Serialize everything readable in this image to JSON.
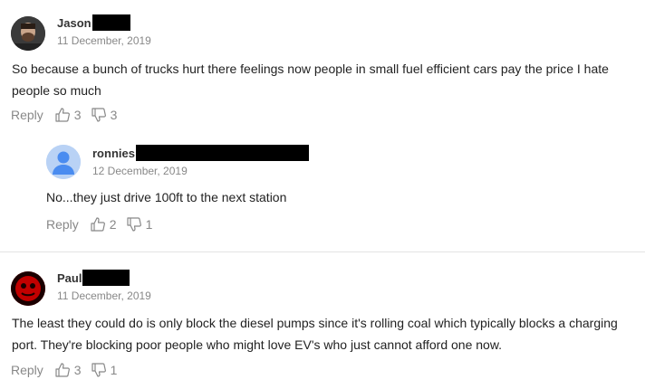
{
  "comments": [
    {
      "name": "Jason",
      "date": "11 December, 2019",
      "text": "So because a bunch of trucks hurt there feelings now people in small fuel efficient cars pay the price I hate people so much",
      "reply_label": "Reply",
      "likes": "3",
      "dislikes": "3"
    },
    {
      "name": "ronnies",
      "date": "12 December, 2019",
      "text": "No...they just drive 100ft to the next station",
      "reply_label": "Reply",
      "likes": "2",
      "dislikes": "1"
    },
    {
      "name": "Paul",
      "date": "11 December, 2019",
      "text": "The least they could do is only block the diesel pumps since it's rolling coal which typically blocks a charging port. They're blocking poor people who might love EV's who just cannot afford one now.",
      "reply_label": "Reply",
      "likes": "3",
      "dislikes": "1"
    }
  ],
  "icons": {
    "like": "thumbs-up-icon",
    "dislike": "thumbs-down-icon",
    "default_avatar": "default-user-avatar-icon"
  },
  "colors": {
    "default_avatar_bg": "#b9d2f5",
    "default_avatar_fg": "#4a8cf0",
    "paul_avatar_bg": "#c20000"
  }
}
